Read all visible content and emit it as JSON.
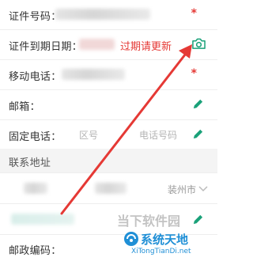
{
  "form": {
    "id_number_label": "证件号码：",
    "expiry_label": "证件到期日期：",
    "expiry_warning": "过期请更新",
    "mobile_label": "移动电话：",
    "email_label": "邮箱：",
    "landline_label": "固定电话：",
    "area_code_placeholder": "区号",
    "phone_placeholder": "电话号码",
    "contact_section_label": "联系地址",
    "city_fragment": "装州市",
    "postal_label": "邮政编码：",
    "required_mark": "*"
  },
  "watermark": {
    "primary": "当下软件园",
    "brand": "系统天地",
    "domain": "XiTongTianDi.net"
  },
  "colors": {
    "required": "#e53935",
    "accent_green": "#1aa179",
    "arrow_red": "#e53935",
    "watermark_blue": "#1f8fd6"
  },
  "icons": {
    "edit": "pencil-icon",
    "camera": "camera-icon",
    "dropdown": "chevron-down-icon"
  }
}
